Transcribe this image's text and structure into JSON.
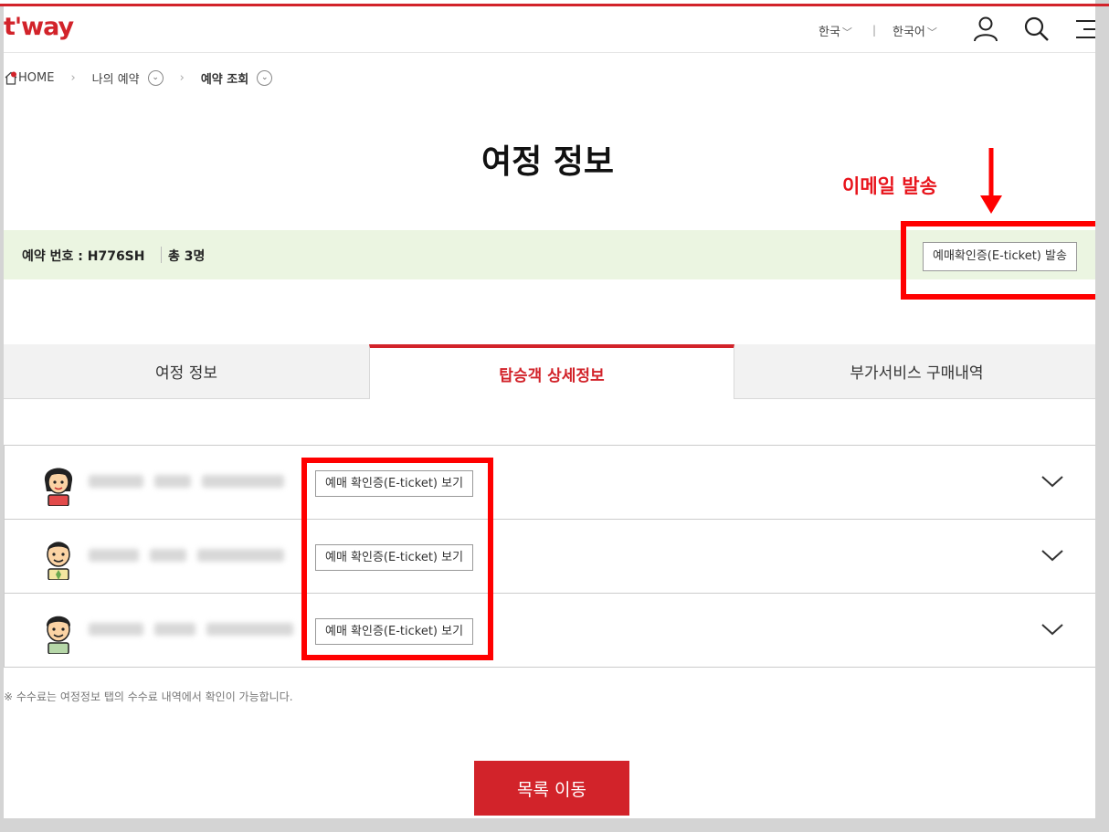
{
  "header": {
    "logo": "t'way",
    "country_select": "한국",
    "language_select": "한국어",
    "separator": "|"
  },
  "breadcrumb": {
    "home": "HOME",
    "level1": "나의 예약",
    "level2": "예약 조회"
  },
  "page_title": "여정 정보",
  "annotation": {
    "email_label": "이메일 발송"
  },
  "reservation": {
    "number_label": "예약 번호 : H776SH",
    "count_label": "총 3명",
    "send_button": "예매확인증(E-ticket) 발송"
  },
  "tabs": [
    {
      "label": "여정 정보",
      "active": false
    },
    {
      "label": "탑승객 상세정보",
      "active": true
    },
    {
      "label": "부가서비스 구매내역",
      "active": false
    }
  ],
  "passengers": [
    {
      "avatar": "female-avatar-icon",
      "button": "예매 확인증(E-ticket) 보기"
    },
    {
      "avatar": "male-avatar-icon",
      "button": "예매 확인증(E-ticket) 보기"
    },
    {
      "avatar": "child-avatar-icon",
      "button": "예매 확인증(E-ticket) 보기"
    }
  ],
  "note": "※ 수수료는 여정정보 탭의 수수료 내역에서 확인이 가능합니다.",
  "list_button": "목록 이동",
  "colors": {
    "brand_red": "#d2232a",
    "annotation_red": "#ff0000",
    "reservation_bg": "#ebf5e1"
  }
}
